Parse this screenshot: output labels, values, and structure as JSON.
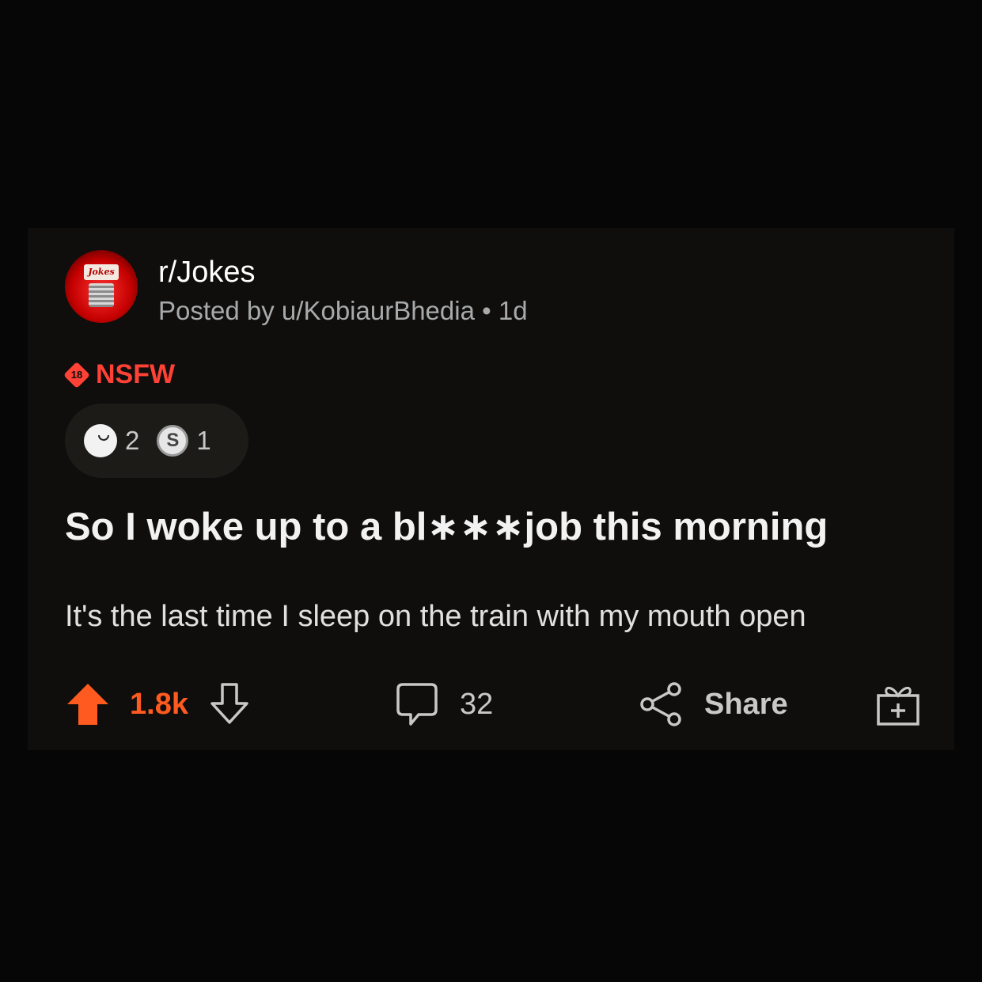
{
  "post": {
    "subreddit": "r/Jokes",
    "subreddit_icon_text": "Jokes",
    "posted_by": "Posted by u/KobiaurBhedia",
    "separator": "•",
    "age": "1d",
    "nsfw_badge_number": "18",
    "nsfw_label": "NSFW",
    "awards": [
      {
        "icon": "laughing-face-icon",
        "count": "2"
      },
      {
        "icon": "silver-award-icon",
        "count": "1"
      }
    ],
    "title": "So I woke up to a bl∗∗∗job this morning",
    "body": "It's the last time I sleep on the train with my mouth open"
  },
  "actions": {
    "upvote_icon": "upvote-arrow-icon",
    "vote_count": "1.8k",
    "downvote_icon": "downvote-arrow-icon",
    "comment_icon": "comment-bubble-icon",
    "comment_count": "32",
    "share_icon": "share-icon",
    "share_label": "Share",
    "award_icon": "gift-icon"
  },
  "colors": {
    "background": "#060606",
    "card": "#0f0e0c",
    "accent_orange": "#ff5a1f",
    "nsfw_red": "#ff4136"
  }
}
